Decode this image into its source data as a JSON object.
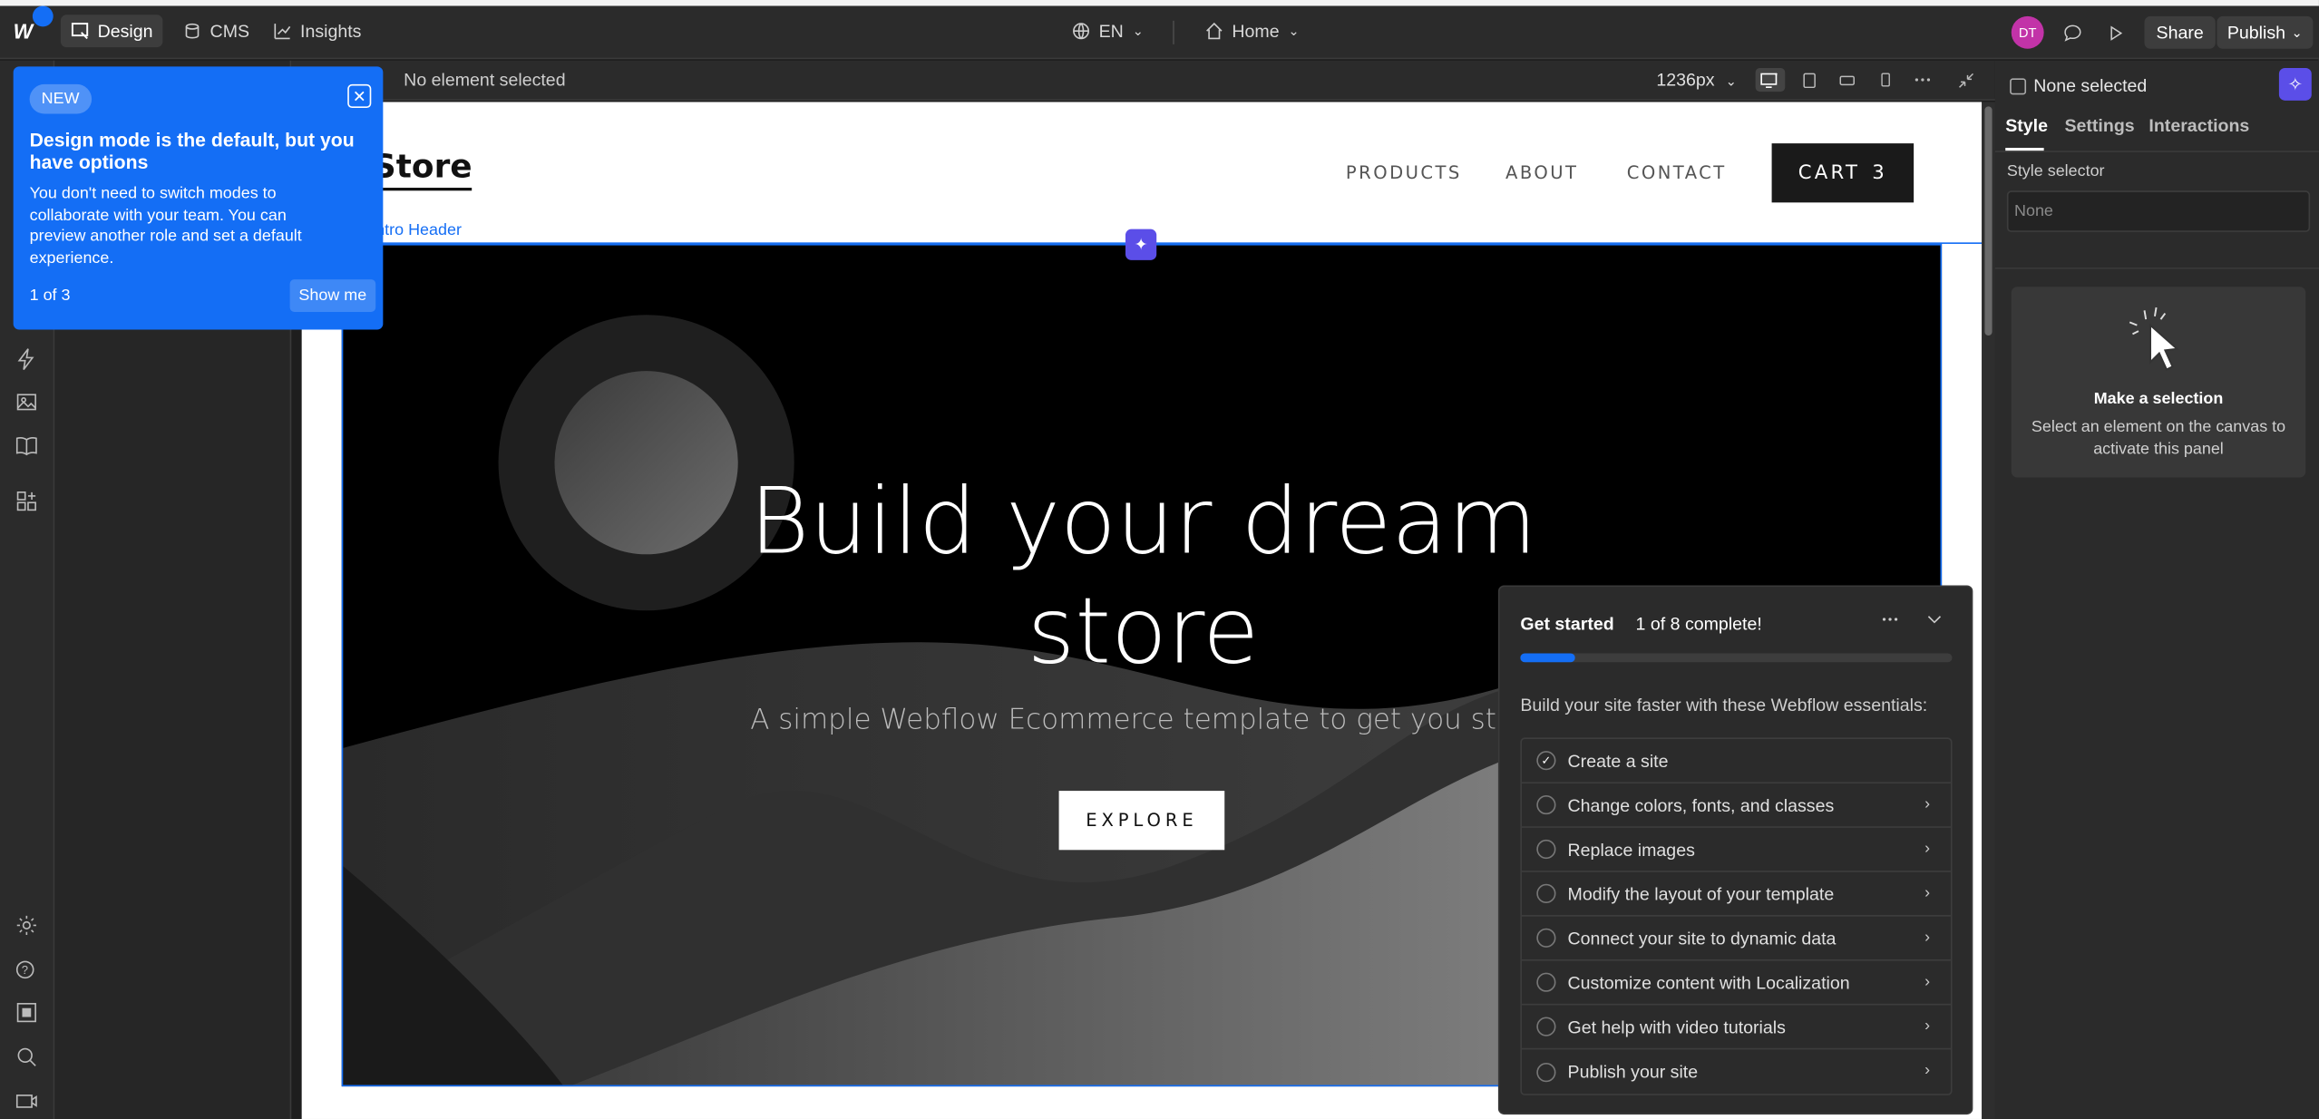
{
  "topbar": {
    "design_label": "Design",
    "cms_label": "CMS",
    "insights_label": "Insights",
    "language": "EN",
    "page": "Home",
    "avatar_initials": "DT",
    "share_label": "Share",
    "publish_label": "Publish"
  },
  "canvas_header": {
    "selection_text": "No element selected",
    "width_value": "1236px"
  },
  "site": {
    "brand": "Store",
    "nav": [
      "PRODUCTS",
      "ABOUT",
      "CONTACT"
    ],
    "cart_label": "CART",
    "cart_count": "3",
    "section_label": "ntro Header",
    "hero_title_line1": "Build your dream",
    "hero_title_line2": "store",
    "hero_subtitle": "A simple Webflow Ecommerce template to get you start",
    "cta_label": "EXPLORE"
  },
  "tooltip": {
    "badge": "NEW",
    "title": "Design mode is the default, but you have options",
    "body": "You don't need to switch modes to collaborate with your team. You can preview another role and set a default experience.",
    "step": "1 of 3",
    "action": "Show me"
  },
  "right_panel": {
    "selection": "None selected",
    "tabs": [
      "Style",
      "Settings",
      "Interactions"
    ],
    "style_selector_label": "Style selector",
    "style_selector_placeholder": "None",
    "empty_title": "Make a selection",
    "empty_text": "Select an element on the canvas to activate this panel"
  },
  "get_started": {
    "title": "Get started",
    "progress_text": "1 of 8 complete!",
    "progress": 0.125,
    "subtitle": "Build your site faster with these Webflow essentials:",
    "items": [
      {
        "label": "Create a site",
        "done": true
      },
      {
        "label": "Change colors, fonts, and classes",
        "done": false
      },
      {
        "label": "Replace images",
        "done": false
      },
      {
        "label": "Modify the layout of your template",
        "done": false
      },
      {
        "label": "Connect your site to dynamic data",
        "done": false
      },
      {
        "label": "Customize content with Localization",
        "done": false
      },
      {
        "label": "Get help with video tutorials",
        "done": false
      },
      {
        "label": "Publish your site",
        "done": false
      }
    ]
  },
  "colors": {
    "accent": "#146ef5",
    "ai": "#5b4ee8",
    "avatar": "#c233a8"
  }
}
